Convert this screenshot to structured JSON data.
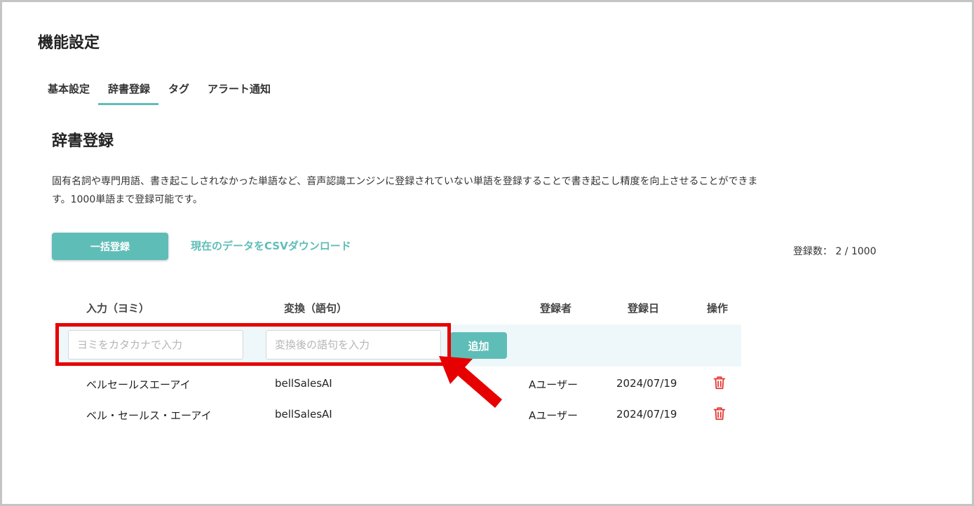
{
  "page": {
    "title": "機能設定"
  },
  "tabs": [
    {
      "label": "基本設定",
      "active": false
    },
    {
      "label": "辞書登録",
      "active": true
    },
    {
      "label": "タグ",
      "active": false
    },
    {
      "label": "アラート通知",
      "active": false
    }
  ],
  "section": {
    "title": "辞書登録",
    "description_line1": "固有名詞や専門用語、書き起こしされなかった単語など、音声認識エンジンに登録されていない単語を登録することで書き起こし精度を向上させることができま",
    "description_line2": "す。1000単語まで登録可能です。"
  },
  "actions": {
    "bulk_register_label": "一括登録",
    "csv_download_label": "現在のデータをCSVダウンロード",
    "registration_count": "登録数： 2 / 1000"
  },
  "table": {
    "headers": {
      "reading": "入力（ヨミ）",
      "conversion": "変換（語句）",
      "registrant": "登録者",
      "date": "登録日",
      "operation": "操作"
    },
    "input_row": {
      "reading_placeholder": "ヨミをカタカナで入力",
      "conversion_placeholder": "変換後の語句を入力",
      "add_label": "追加"
    },
    "rows": [
      {
        "reading": "ベルセールスエーアイ",
        "conversion": "bellSalesAI",
        "registrant": "Aユーザー",
        "date": "2024/07/19",
        "action_icon": "trash-icon"
      },
      {
        "reading": "ベル・セールス・エーアイ",
        "conversion": "bellSalesAI",
        "registrant": "Aユーザー",
        "date": "2024/07/19",
        "action_icon": "trash-icon"
      }
    ]
  },
  "colors": {
    "accent": "#5fbdb8",
    "highlight": "#e60000",
    "delete": "#e53935",
    "input_row_bg": "#eef8fa"
  }
}
